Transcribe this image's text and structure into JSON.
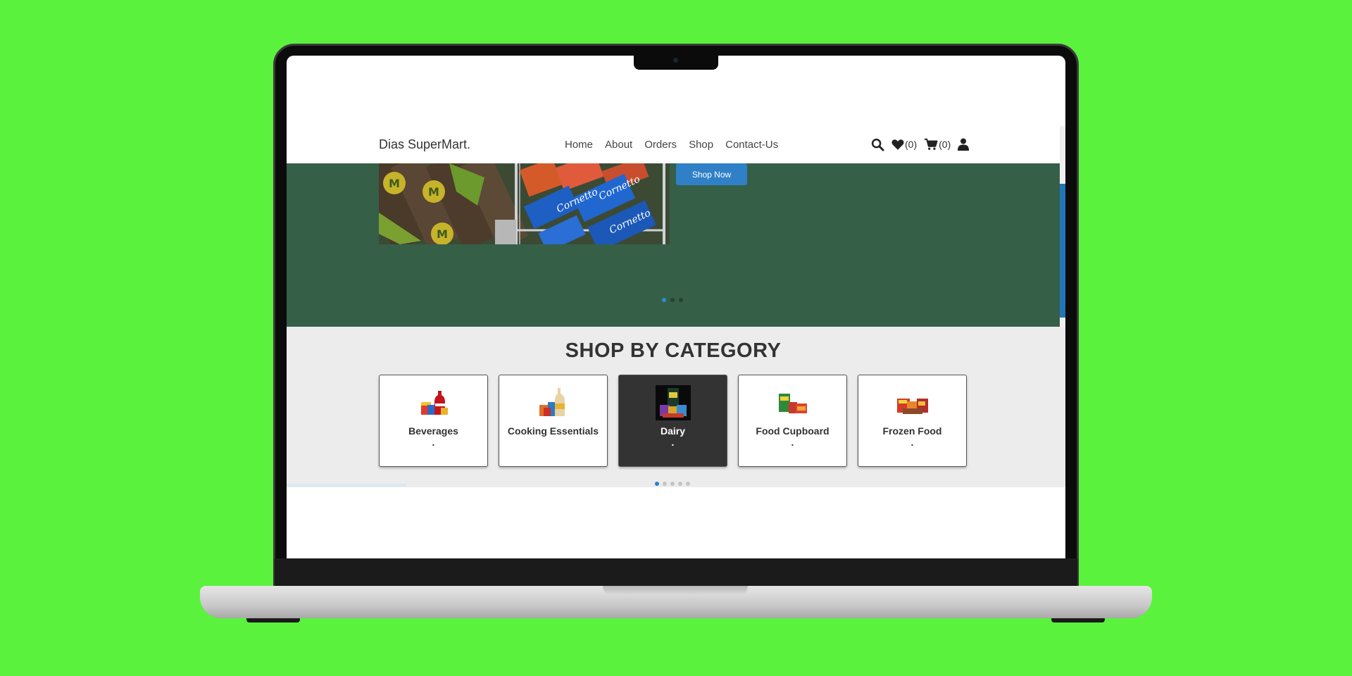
{
  "site": {
    "brand": "Dias SuperMart."
  },
  "nav": {
    "links": [
      "Home",
      "About",
      "Orders",
      "Shop",
      "Contact-Us"
    ],
    "wishlist_count": "(0)",
    "cart_count": "(0)"
  },
  "hero": {
    "button_label": "Shop Now",
    "slide_count": 3,
    "active_slide": 1
  },
  "categories": {
    "title": "SHOP BY CATEGORY",
    "items": [
      {
        "label": "Beverages",
        "sub": "."
      },
      {
        "label": "Cooking Essentials",
        "sub": ""
      },
      {
        "label": "Dairy",
        "sub": ".",
        "active": true
      },
      {
        "label": "Food Cupboard",
        "sub": "."
      },
      {
        "label": "Frozen Food",
        "sub": "."
      }
    ],
    "page_count": 5,
    "active_page": 1
  },
  "colors": {
    "background": "#5bf23e",
    "hero_bg": "#365f48",
    "accent": "#2f80c6",
    "active_card": "#333333",
    "section_bg": "#ececec"
  },
  "icons": [
    "search-icon",
    "heart-icon",
    "cart-icon",
    "user-icon"
  ]
}
